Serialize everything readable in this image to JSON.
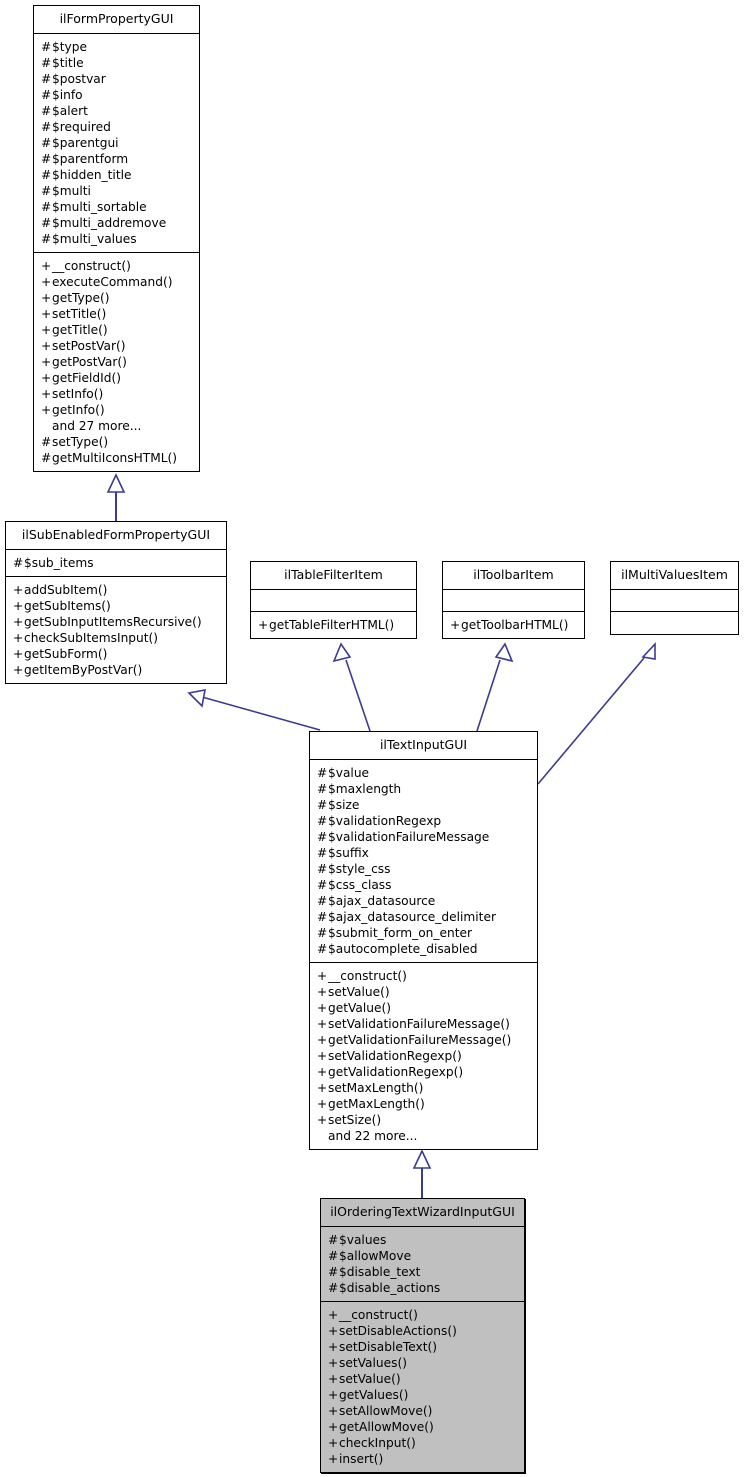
{
  "diagram": {
    "type": "uml-class-inheritance-diagram",
    "line_color": "#3b3b8f",
    "highlight_fill": "#c0c0c0",
    "box_fill": "#ffffff",
    "border_color": "#000000"
  },
  "classes": [
    {
      "id": "ilFormPropertyGUI",
      "name": "ilFormPropertyGUI",
      "highlighted": false,
      "attributes": [
        {
          "visibility": "#",
          "label": "$type"
        },
        {
          "visibility": "#",
          "label": "$title"
        },
        {
          "visibility": "#",
          "label": "$postvar"
        },
        {
          "visibility": "#",
          "label": "$info"
        },
        {
          "visibility": "#",
          "label": "$alert"
        },
        {
          "visibility": "#",
          "label": "$required"
        },
        {
          "visibility": "#",
          "label": "$parentgui"
        },
        {
          "visibility": "#",
          "label": "$parentform"
        },
        {
          "visibility": "#",
          "label": "$hidden_title"
        },
        {
          "visibility": "#",
          "label": "$multi"
        },
        {
          "visibility": "#",
          "label": "$multi_sortable"
        },
        {
          "visibility": "#",
          "label": "$multi_addremove"
        },
        {
          "visibility": "#",
          "label": "$multi_values"
        }
      ],
      "methods": [
        {
          "visibility": "+",
          "label": "__construct()"
        },
        {
          "visibility": "+",
          "label": "executeCommand()"
        },
        {
          "visibility": "+",
          "label": "getType()"
        },
        {
          "visibility": "+",
          "label": "setTitle()"
        },
        {
          "visibility": "+",
          "label": "getTitle()"
        },
        {
          "visibility": "+",
          "label": "setPostVar()"
        },
        {
          "visibility": "+",
          "label": "getPostVar()"
        },
        {
          "visibility": "+",
          "label": "getFieldId()"
        },
        {
          "visibility": "+",
          "label": "setInfo()"
        },
        {
          "visibility": "+",
          "label": "getInfo()"
        },
        {
          "visibility": "",
          "label": "and 27 more..."
        },
        {
          "visibility": "#",
          "label": "setType()"
        },
        {
          "visibility": "#",
          "label": "getMultiIconsHTML()"
        }
      ]
    },
    {
      "id": "ilSubEnabledFormPropertyGUI",
      "name": "ilSubEnabledFormPropertyGUI",
      "highlighted": false,
      "attributes": [
        {
          "visibility": "#",
          "label": "$sub_items"
        }
      ],
      "methods": [
        {
          "visibility": "+",
          "label": "addSubItem()"
        },
        {
          "visibility": "+",
          "label": "getSubItems()"
        },
        {
          "visibility": "+",
          "label": "getSubInputItemsRecursive()"
        },
        {
          "visibility": "+",
          "label": "checkSubItemsInput()"
        },
        {
          "visibility": "+",
          "label": "getSubForm()"
        },
        {
          "visibility": "+",
          "label": "getItemByPostVar()"
        }
      ]
    },
    {
      "id": "ilTableFilterItem",
      "name": "ilTableFilterItem",
      "highlighted": false,
      "attributes": [],
      "methods": [
        {
          "visibility": "+",
          "label": "getTableFilterHTML()"
        }
      ]
    },
    {
      "id": "ilToolbarItem",
      "name": "ilToolbarItem",
      "highlighted": false,
      "attributes": [],
      "methods": [
        {
          "visibility": "+",
          "label": "getToolbarHTML()"
        }
      ]
    },
    {
      "id": "ilMultiValuesItem",
      "name": "ilMultiValuesItem",
      "highlighted": false,
      "attributes": [],
      "methods": []
    },
    {
      "id": "ilTextInputGUI",
      "name": "ilTextInputGUI",
      "highlighted": false,
      "attributes": [
        {
          "visibility": "#",
          "label": "$value"
        },
        {
          "visibility": "#",
          "label": "$maxlength"
        },
        {
          "visibility": "#",
          "label": "$size"
        },
        {
          "visibility": "#",
          "label": "$validationRegexp"
        },
        {
          "visibility": "#",
          "label": "$validationFailureMessage"
        },
        {
          "visibility": "#",
          "label": "$suffix"
        },
        {
          "visibility": "#",
          "label": "$style_css"
        },
        {
          "visibility": "#",
          "label": "$css_class"
        },
        {
          "visibility": "#",
          "label": "$ajax_datasource"
        },
        {
          "visibility": "#",
          "label": "$ajax_datasource_delimiter"
        },
        {
          "visibility": "#",
          "label": "$submit_form_on_enter"
        },
        {
          "visibility": "#",
          "label": "$autocomplete_disabled"
        }
      ],
      "methods": [
        {
          "visibility": "+",
          "label": "__construct()"
        },
        {
          "visibility": "+",
          "label": "setValue()"
        },
        {
          "visibility": "+",
          "label": "getValue()"
        },
        {
          "visibility": "+",
          "label": "setValidationFailureMessage()"
        },
        {
          "visibility": "+",
          "label": "getValidationFailureMessage()"
        },
        {
          "visibility": "+",
          "label": "setValidationRegexp()"
        },
        {
          "visibility": "+",
          "label": "getValidationRegexp()"
        },
        {
          "visibility": "+",
          "label": "setMaxLength()"
        },
        {
          "visibility": "+",
          "label": "getMaxLength()"
        },
        {
          "visibility": "+",
          "label": "setSize()"
        },
        {
          "visibility": "",
          "label": "and 22 more..."
        }
      ]
    },
    {
      "id": "ilOrderingTextWizardInputGUI",
      "name": "ilOrderingTextWizardInputGUI",
      "highlighted": true,
      "attributes": [
        {
          "visibility": "#",
          "label": "$values"
        },
        {
          "visibility": "#",
          "label": "$allowMove"
        },
        {
          "visibility": "#",
          "label": "$disable_text"
        },
        {
          "visibility": "#",
          "label": "$disable_actions"
        }
      ],
      "methods": [
        {
          "visibility": "+",
          "label": "__construct()"
        },
        {
          "visibility": "+",
          "label": "setDisableActions()"
        },
        {
          "visibility": "+",
          "label": "setDisableText()"
        },
        {
          "visibility": "+",
          "label": "setValues()"
        },
        {
          "visibility": "+",
          "label": "setValue()"
        },
        {
          "visibility": "+",
          "label": "getValues()"
        },
        {
          "visibility": "+",
          "label": "setAllowMove()"
        },
        {
          "visibility": "+",
          "label": "getAllowMove()"
        },
        {
          "visibility": "+",
          "label": "checkInput()"
        },
        {
          "visibility": "+",
          "label": "insert()"
        }
      ]
    }
  ],
  "relations": [
    {
      "from": "ilSubEnabledFormPropertyGUI",
      "to": "ilFormPropertyGUI",
      "kind": "generalization"
    },
    {
      "from": "ilTextInputGUI",
      "to": "ilSubEnabledFormPropertyGUI",
      "kind": "generalization"
    },
    {
      "from": "ilTextInputGUI",
      "to": "ilTableFilterItem",
      "kind": "generalization"
    },
    {
      "from": "ilTextInputGUI",
      "to": "ilToolbarItem",
      "kind": "generalization"
    },
    {
      "from": "ilTextInputGUI",
      "to": "ilMultiValuesItem",
      "kind": "generalization"
    },
    {
      "from": "ilOrderingTextWizardInputGUI",
      "to": "ilTextInputGUI",
      "kind": "generalization"
    }
  ]
}
